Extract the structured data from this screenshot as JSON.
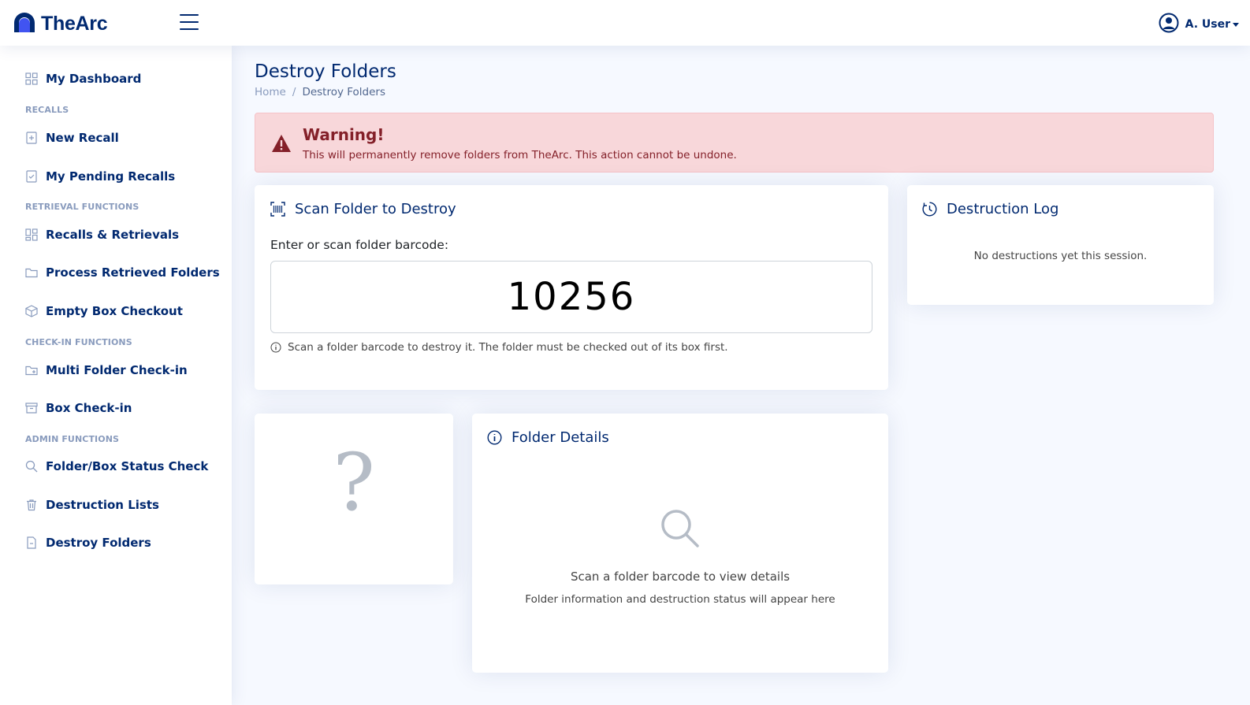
{
  "brand": {
    "name": "TheArc"
  },
  "header": {
    "user_name": "A. User"
  },
  "sidebar": {
    "dashboard": "My Dashboard",
    "headings": {
      "recalls": "RECALLS",
      "retrieval": "RETRIEVAL FUNCTIONS",
      "checkin": "CHECK-IN FUNCTIONS",
      "admin": "ADMIN FUNCTIONS"
    },
    "items": {
      "new_recall": "New Recall",
      "pending_recalls": "My Pending Recalls",
      "recalls_retrievals": "Recalls & Retrievals",
      "process_retrieved": "Process Retrieved Folders",
      "empty_box": "Empty Box Checkout",
      "multi_folder": "Multi Folder Check-in",
      "box_checkin": "Box Check-in",
      "status_check": "Folder/Box Status Check",
      "destruction_lists": "Destruction Lists",
      "destroy_folders": "Destroy Folders"
    }
  },
  "page": {
    "title": "Destroy Folders",
    "breadcrumb": {
      "home": "Home",
      "separator": "/",
      "current": "Destroy Folders"
    }
  },
  "alert": {
    "title": "Warning!",
    "text": "This will permanently remove folders from TheArc. This action cannot be undone."
  },
  "scan": {
    "title": "Scan Folder to Destroy",
    "label": "Enter or scan folder barcode:",
    "value": "10256",
    "hint": "Scan a folder barcode to destroy it. The folder must be checked out of its box first."
  },
  "log": {
    "title": "Destruction Log",
    "empty": "No destructions yet this session."
  },
  "preview": {
    "placeholder": "?"
  },
  "details": {
    "title": "Folder Details",
    "empty_title": "Scan a folder barcode to view details",
    "empty_sub": "Folder information and destruction status will appear here"
  },
  "colors": {
    "primary": "#012970",
    "muted": "#899bbd",
    "danger_bg": "#f8d7da",
    "danger_text": "#842029",
    "page_bg": "#f6f9ff"
  },
  "icons": [
    "logo-arch-icon",
    "menu-icon",
    "user-circle-icon",
    "grid-icon",
    "recall-add-icon",
    "check-list-icon",
    "grid-icon",
    "folder-icon",
    "box-icon",
    "folder-add-icon",
    "archive-icon",
    "search-icon",
    "trash-icon",
    "file-minus-icon",
    "warning-icon",
    "barcode-scan-icon",
    "clock-history-icon",
    "info-circle-icon",
    "magnifier-icon"
  ]
}
